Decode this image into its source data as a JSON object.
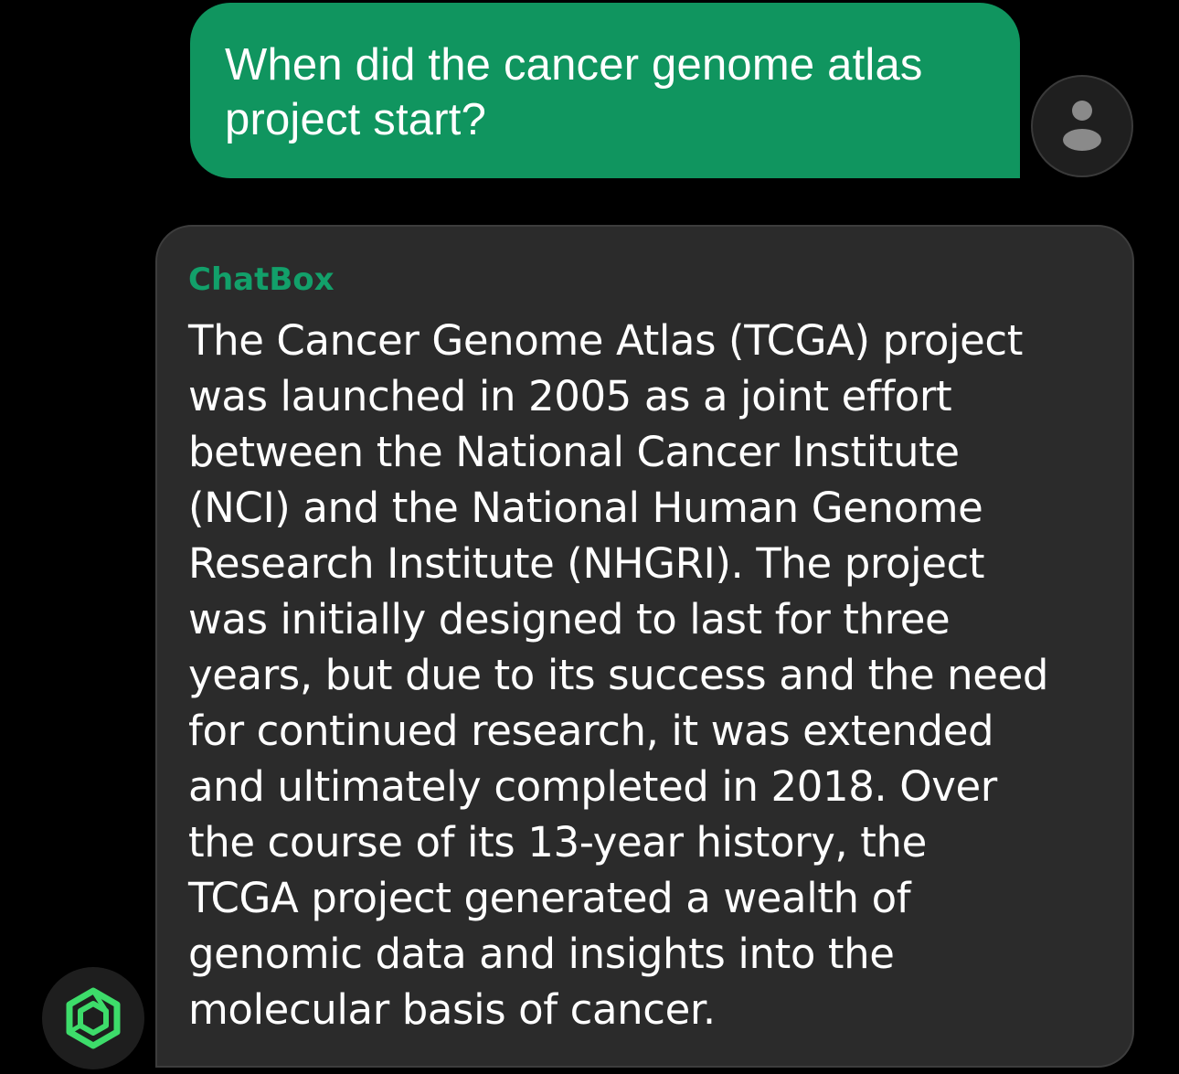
{
  "user_message": {
    "text": "When did the cancer genome atlas\nproject start?",
    "bubble_color": "#10955f",
    "avatar_icon": "user-icon"
  },
  "bot_message": {
    "sender": "ChatBox",
    "sender_color": "#12a06a",
    "text": "The Cancer Genome Atlas (TCGA) project\nwas launched in 2005 as a joint effort\nbetween the National Cancer Institute\n(NCI) and the National Human Genome\nResearch Institute (NHGRI). The project\nwas initially designed to last for three\nyears, but due to its success and the need\nfor continued research, it was extended\nand ultimately completed in 2018. Over\nthe course of its 13-year history, the\nTCGA project generated a wealth of\ngenomic data and insights into the\nmolecular basis of cancer.",
    "bubble_color": "#2b2b2b",
    "avatar_icon": "chatbox-logo-icon",
    "logo_color": "#3ddc6a"
  }
}
